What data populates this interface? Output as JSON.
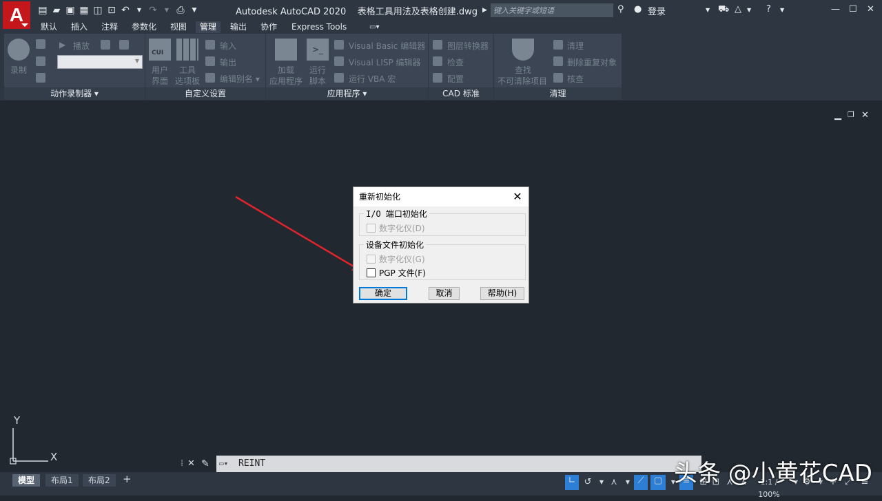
{
  "app": {
    "logo_letter": "A",
    "title": "Autodesk AutoCAD 2020",
    "file": "表格工具用法及表格创建.dwg"
  },
  "search": {
    "placeholder": "键入关键字或短语"
  },
  "user": {
    "login": "登录"
  },
  "tabs": [
    "默认",
    "插入",
    "注释",
    "参数化",
    "视图",
    "管理",
    "输出",
    "协作",
    "Express Tools"
  ],
  "active_tab": "管理",
  "ribbon": {
    "action_recorder": {
      "title": "动作录制器",
      "record": "录制",
      "play": "播放"
    },
    "customization": {
      "title": "自定义设置",
      "user_interface": [
        "用户",
        "界面"
      ],
      "tool_palettes": [
        "工具",
        "选项板"
      ],
      "import": "输入",
      "export": "输出",
      "edit_aliases": "编辑别名",
      "cui_label": "CUI"
    },
    "applications": {
      "title": "应用程序",
      "load_app": [
        "加载",
        "应用程序"
      ],
      "run_script": [
        "运行",
        "脚本"
      ],
      "vba_editor": "Visual Basic 编辑器",
      "lisp_editor": "Visual LISP 编辑器",
      "run_vba": "运行 VBA 宏"
    },
    "cad_standards": {
      "title": "CAD 标准",
      "layer_translator": "图层转换器",
      "check": "检查",
      "configure": "配置"
    },
    "cleanup": {
      "title": "清理",
      "find_unpurgeable": [
        "查找",
        "不可清除项目"
      ],
      "purge": "清理",
      "overkill": "删除重复对象",
      "audit": "核查"
    }
  },
  "dialog": {
    "title": "重新初始化",
    "io_group": "I/O 端口初始化",
    "io_digitizer": "数字化仪(D)",
    "device_group": "设备文件初始化",
    "device_digitizer": "数字化仪(G)",
    "pgp_file": "PGP 文件(F)",
    "ok": "确定",
    "cancel": "取消",
    "help": "帮助(H)"
  },
  "ucs": {
    "y": "Y",
    "x": "X"
  },
  "command_line": {
    "text": "REINT"
  },
  "layout_tabs": [
    "模型",
    "布局1",
    "布局2"
  ],
  "active_layout": "模型",
  "status": {
    "scale": "1:1 / 100%"
  },
  "watermark": "头条 @小黄花CAD",
  "colors": {
    "accent_red": "#c5161c",
    "annotation_arrow": "#e0242c",
    "dialog_focus": "#0078d7"
  }
}
